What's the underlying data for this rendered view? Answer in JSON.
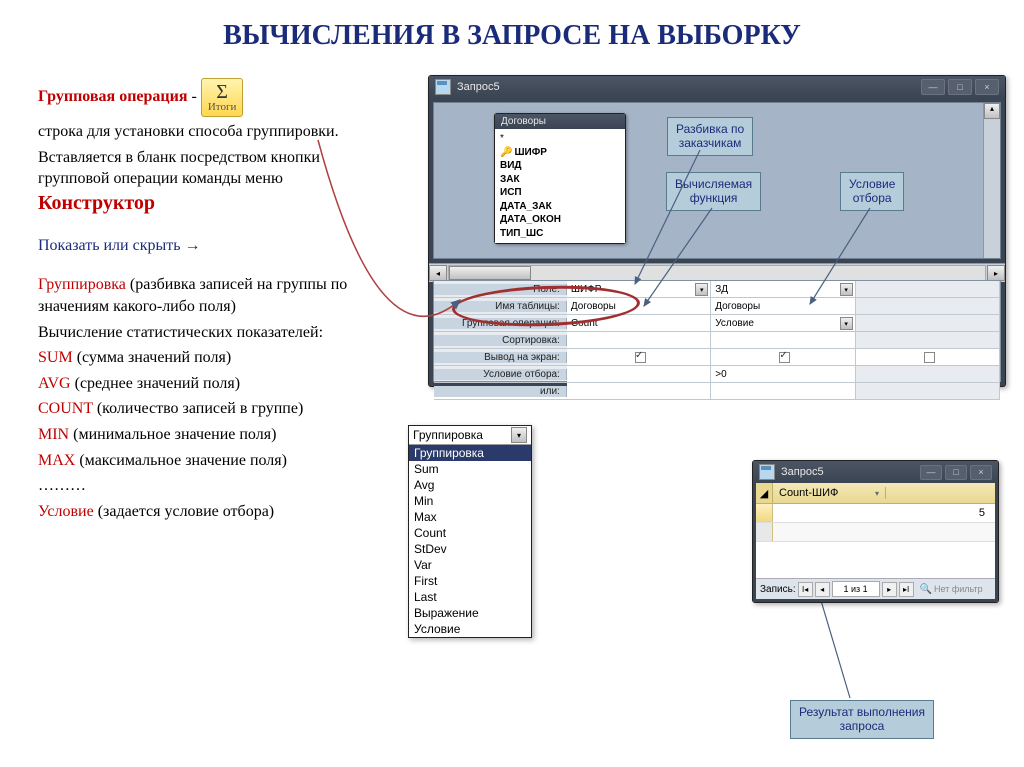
{
  "title": "ВЫЧИСЛЕНИЯ В ЗАПРОСЕ НА ВЫБОРКУ",
  "left": {
    "grp_label": "Групповая операция",
    "grp_dash": " - ",
    "sigma": "Σ",
    "sigma_label": "Итоги",
    "line1": "строка для установки способа группировки.",
    "line2": "Вставляется в бланк посредством кнопки групповой операции команды меню ",
    "constructor": "Конструктор",
    "show_hide": "Показать или скрыть →",
    "grouping": "Группировка",
    "grouping_tail": " (разбивка записей на группы по значениям какого-либо поля)",
    "stat_title": "Вычисление статистических показателей:",
    "sum": "SUM ",
    "sum_tail": "(сумма значений поля)",
    "avg": "AVG ",
    "avg_tail": "(среднее значений поля)",
    "count": "COUNT ",
    "count_tail": "(количество записей в группе)",
    "min": "MIN ",
    "min_tail": "(минимальное значение поля)",
    "max": "MAX ",
    "max_tail": "(максимальное значение поля)",
    "dots": "………",
    "cond": "Условие ",
    "cond_tail": "(задается условие отбора)"
  },
  "callouts": {
    "partition": "Разбивка по\nзаказчикам",
    "fn": "Вычисляемая\nфункция",
    "filter": "Условие\nотбора",
    "result": "Результат выполнения\nзапроса"
  },
  "qwin_title": "Запрос5",
  "fieldlist": {
    "title": "Договоры",
    "items": [
      "*",
      "ШИФР",
      "ВИД",
      "ЗАК",
      "ИСП",
      "ДАТА_ЗАК",
      "ДАТА_ОКОН",
      "ТИП_ШС"
    ]
  },
  "grid": {
    "labels": [
      "Поле:",
      "Имя таблицы:",
      "Групповая операция:",
      "Сортировка:",
      "Вывод на экран:",
      "Условие отбора:",
      "или:"
    ],
    "col1": [
      "ШИФР",
      "Договоры",
      "Count",
      "",
      "",
      "",
      ""
    ],
    "col2": [
      "ЗД",
      "Договоры",
      "Условие",
      "",
      "",
      ">0",
      ""
    ]
  },
  "dropdown": {
    "current": "Группировка",
    "items": [
      "Группировка",
      "Sum",
      "Avg",
      "Min",
      "Max",
      "Count",
      "StDev",
      "Var",
      "First",
      "Last",
      "Выражение",
      "Условие"
    ]
  },
  "result": {
    "title": "Запрос5",
    "col_header": "Count-ШИФ",
    "value": "5",
    "nav_label": "Запись:",
    "nav_pos": "1 из 1",
    "filter": "Нет фильтр"
  }
}
